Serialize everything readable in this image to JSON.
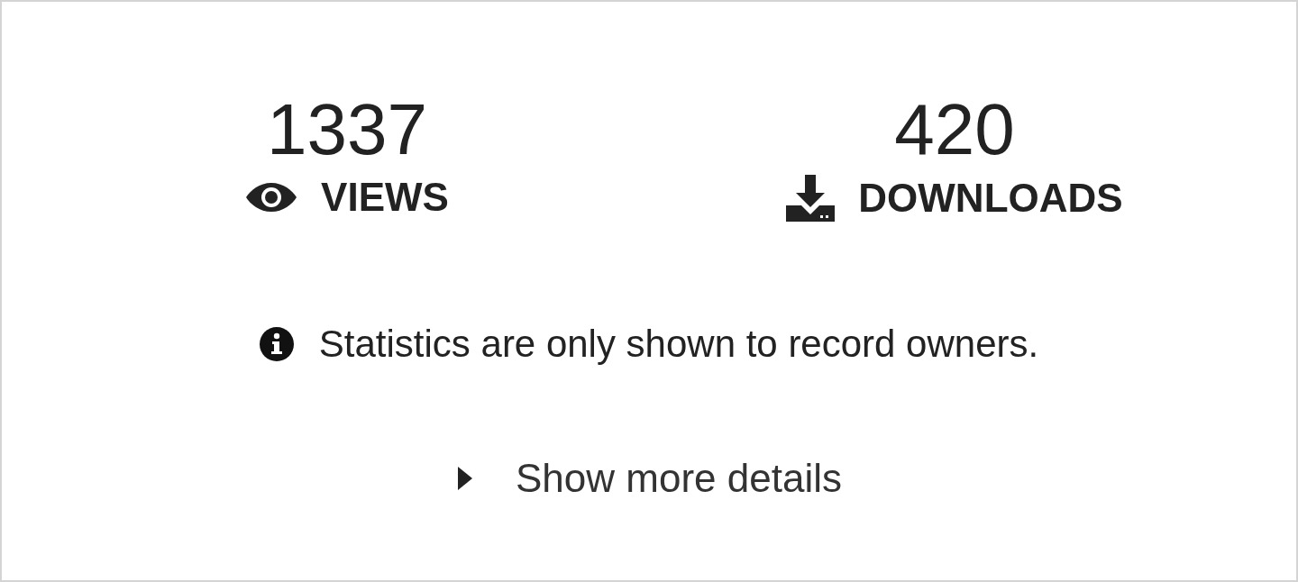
{
  "stats": [
    {
      "kind": "views",
      "value": "1337",
      "label": "VIEWS"
    },
    {
      "kind": "downloads",
      "value": "420",
      "label": "DOWNLOADS"
    }
  ],
  "notice": "Statistics are only shown to record owners.",
  "details_toggle": {
    "label": "Show more details",
    "expanded": false
  }
}
